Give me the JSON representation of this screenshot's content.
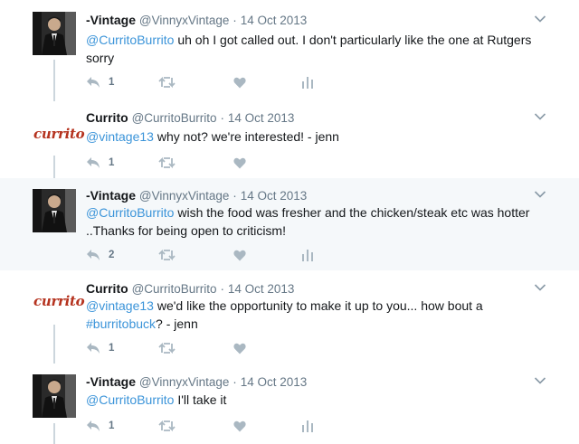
{
  "tweets": [
    {
      "name": "-Vintage",
      "handle": "@VinnyxVintage",
      "sep": "·",
      "date": "14 Oct 2013",
      "mention": "@CurritoBurrito",
      "text": " uh oh I got called out. I don't particularly like the one at Rutgers sorry",
      "reply_count": "1",
      "avatar": "vintage-avatar",
      "has_stats": true
    },
    {
      "name": "Currito",
      "handle": "@CurritoBurrito",
      "sep": "·",
      "date": "14 Oct 2013",
      "mention": "@vintage13",
      "text": " why not? we're interested! - jenn",
      "reply_count": "1",
      "logo_text": "currito",
      "has_stats": false
    },
    {
      "name": "-Vintage",
      "handle": "@VinnyxVintage",
      "sep": "·",
      "date": "14 Oct 2013",
      "mention": "@CurritoBurrito",
      "text": " wish the food was fresher and the chicken/steak etc was hotter ..Thanks for being open to criticism!",
      "reply_count": "2",
      "avatar": "vintage-avatar",
      "has_stats": true
    },
    {
      "name": "Currito",
      "handle": "@CurritoBurrito",
      "sep": "·",
      "date": "14 Oct 2013",
      "mention": "@vintage13",
      "text_a": " we'd like the opportunity to make it up to you... how bout a ",
      "hashtag": "#burritobuck",
      "text_b": "? - jenn",
      "reply_count": "1",
      "logo_text": "currito",
      "has_stats": false
    },
    {
      "name": "-Vintage",
      "handle": "@VinnyxVintage",
      "sep": "·",
      "date": "14 Oct 2013",
      "mention": "@CurritoBurrito",
      "text": " I'll take it",
      "reply_count": "1",
      "avatar": "vintage-avatar",
      "has_stats": true
    }
  ],
  "colors": {
    "link": "#3b94d9",
    "muted": "#657786",
    "highlight_bg": "#f5f8fa",
    "thread_line": "#ccd6dd",
    "brand": "#b5331f"
  },
  "icons": [
    "reply-icon",
    "retweet-icon",
    "like-icon",
    "analytics-icon",
    "chevron-down-icon"
  ]
}
